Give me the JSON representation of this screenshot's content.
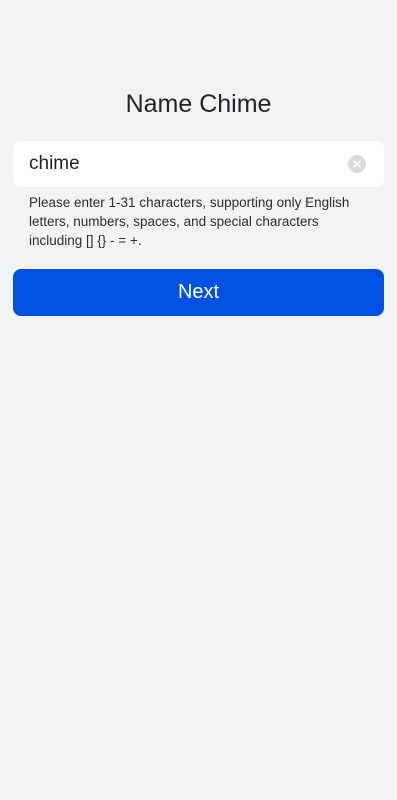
{
  "page": {
    "title": "Name Chime"
  },
  "name_input": {
    "value": "chime",
    "clear_icon": "clear-circle-icon"
  },
  "hint": {
    "text": "Please enter 1-31 characters, supporting only English letters, numbers, spaces, and special characters including [] {} - = +."
  },
  "actions": {
    "next_label": "Next"
  },
  "colors": {
    "background": "#f2f3f5",
    "primary": "#0351e3",
    "input_bg": "#ffffff"
  }
}
